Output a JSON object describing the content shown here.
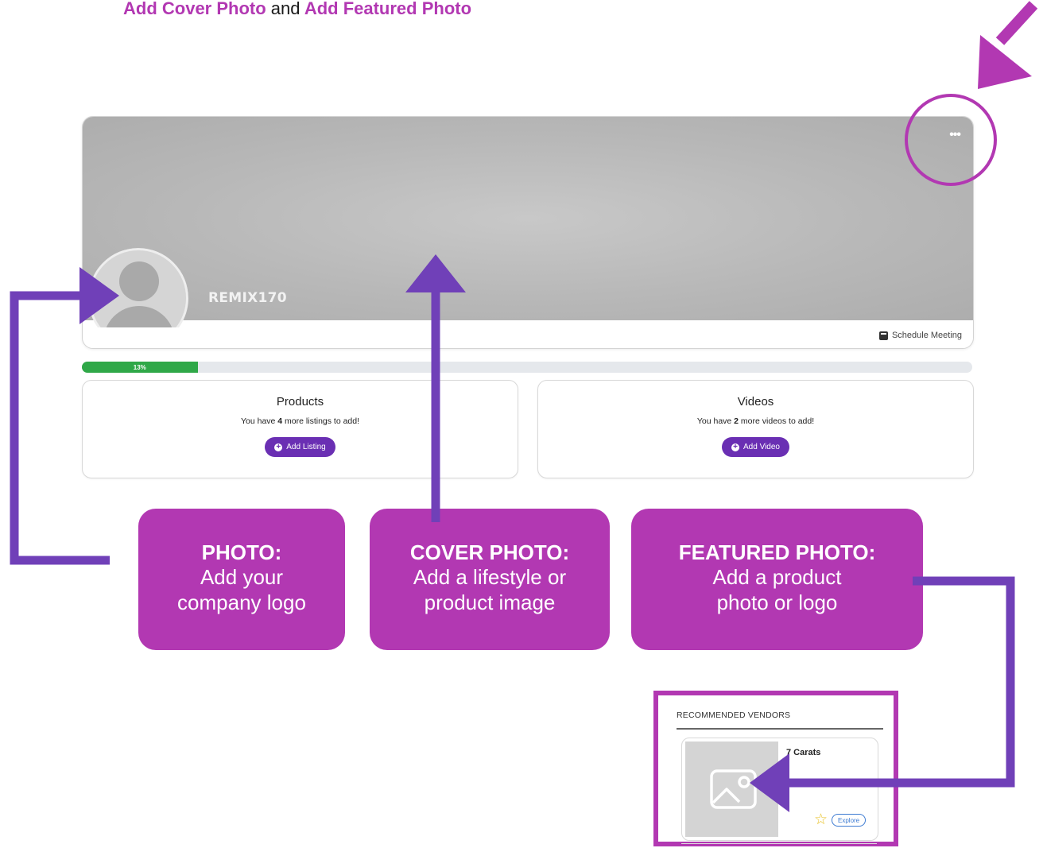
{
  "instruction": {
    "part1": "Add Cover Photo",
    "connector": "and",
    "part2": "Add Featured Photo"
  },
  "profile": {
    "company_name": "REMIX170",
    "more_menu_label": "•••",
    "schedule_meeting_label": "Schedule Meeting"
  },
  "progress": {
    "label": "13%",
    "percent": 13
  },
  "products": {
    "title": "Products",
    "msg_prefix": "You have ",
    "count": "4",
    "msg_suffix": " more listings to add!",
    "button_label": "Add Listing"
  },
  "videos": {
    "title": "Videos",
    "msg_prefix": "You have ",
    "count": "2",
    "msg_suffix": " more videos to add!",
    "button_label": "Add Video"
  },
  "callouts": {
    "photo": {
      "title": "PHOTO:",
      "line1": "Add your",
      "line2": "company logo"
    },
    "cover": {
      "title": "COVER PHOTO:",
      "line1": "Add a lifestyle or",
      "line2": "product image"
    },
    "featured": {
      "title": "FEATURED PHOTO:",
      "line1": "Add a product",
      "line2": "photo or logo"
    }
  },
  "vendors": {
    "heading": "RECOMMENDED VENDORS",
    "item_name": "7 Carats",
    "explore_label": "Explore"
  },
  "colors": {
    "annotation_magenta": "#b238b2",
    "arrow_purple": "#7040b8",
    "button_purple": "#6a2fb3",
    "progress_green": "#2fa848",
    "explore_blue": "#3d7bd2",
    "star_yellow": "#e8c227"
  },
  "icons": {
    "more_menu": "ellipsis-icon",
    "schedule": "calendar-icon",
    "add": "plus-circle-icon",
    "favorite": "star-icon",
    "placeholder": "image-placeholder-icon",
    "avatar": "user-icon"
  }
}
